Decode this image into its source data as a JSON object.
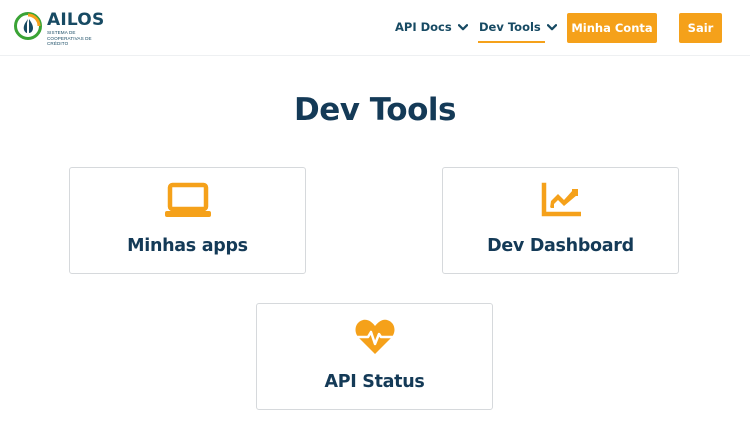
{
  "header": {
    "logo": {
      "name": "AILOS",
      "subtitle": "SISTEMA DE COOPERATIVAS DE CRÉDITO"
    },
    "nav": [
      {
        "label": "API Docs",
        "icon": "chevron-down-icon"
      },
      {
        "label": "Dev Tools",
        "icon": "chevron-down-icon",
        "active": true
      }
    ],
    "buttons": {
      "account": "Minha Conta",
      "logout": "Sair"
    }
  },
  "main": {
    "title": "Dev Tools",
    "cards": [
      {
        "label": "Minhas apps",
        "icon": "laptop-icon"
      },
      {
        "label": "Dev Dashboard",
        "icon": "chart-area-icon"
      },
      {
        "label": "API Status",
        "icon": "heartbeat-icon"
      }
    ]
  },
  "colors": {
    "accent": "#f5a11a",
    "primary_text": "#143a57",
    "logo_blue": "#174a63",
    "logo_green": "#3aa335"
  }
}
